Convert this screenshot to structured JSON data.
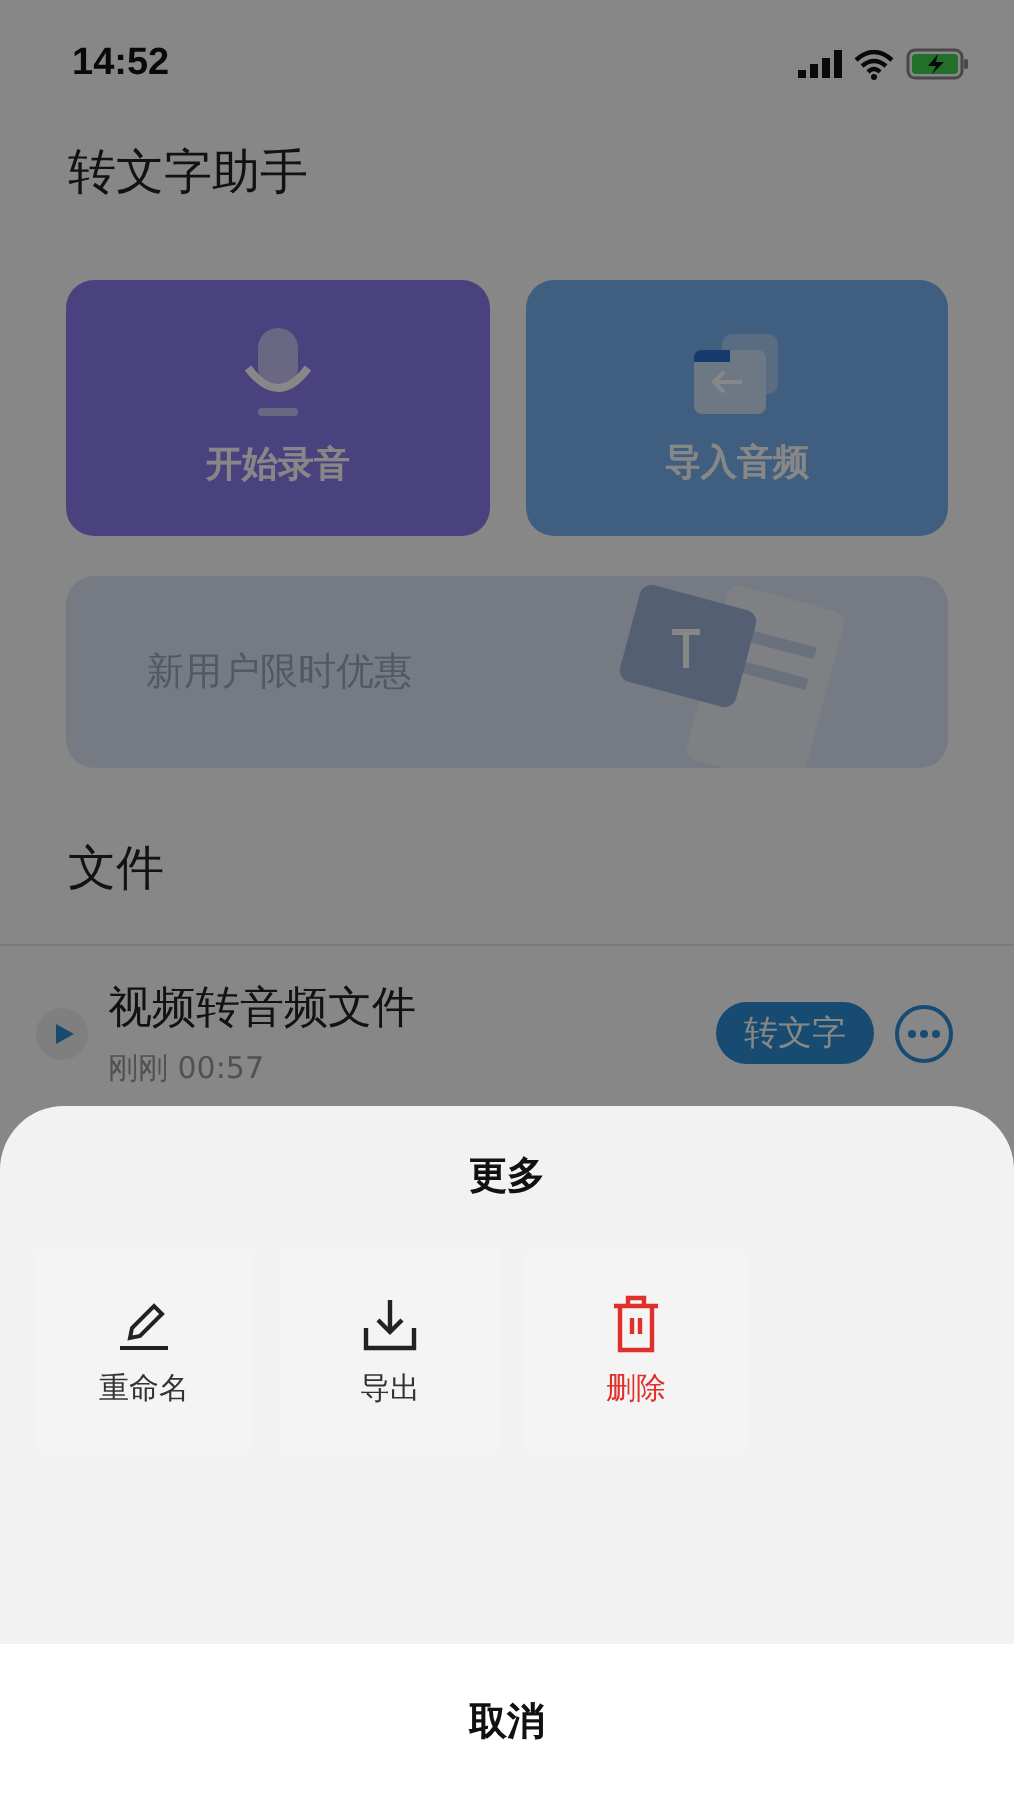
{
  "status_bar": {
    "time": "14:52"
  },
  "page": {
    "title": "转文字助手",
    "cards": [
      {
        "kind": "record",
        "label": "开始录音"
      },
      {
        "kind": "import",
        "label": "导入音频"
      }
    ],
    "banner": {
      "text": "新用户限时优惠"
    },
    "section_title": "文件",
    "files": [
      {
        "name": "视频转音频文件",
        "meta": "刚刚 00:57",
        "action": "转文字"
      }
    ]
  },
  "sheet": {
    "title": "更多",
    "actions": [
      {
        "kind": "rename",
        "label": "重命名",
        "danger": false
      },
      {
        "kind": "export",
        "label": "导出",
        "danger": false
      },
      {
        "kind": "delete",
        "label": "删除",
        "danger": true
      }
    ],
    "cancel": "取消"
  }
}
